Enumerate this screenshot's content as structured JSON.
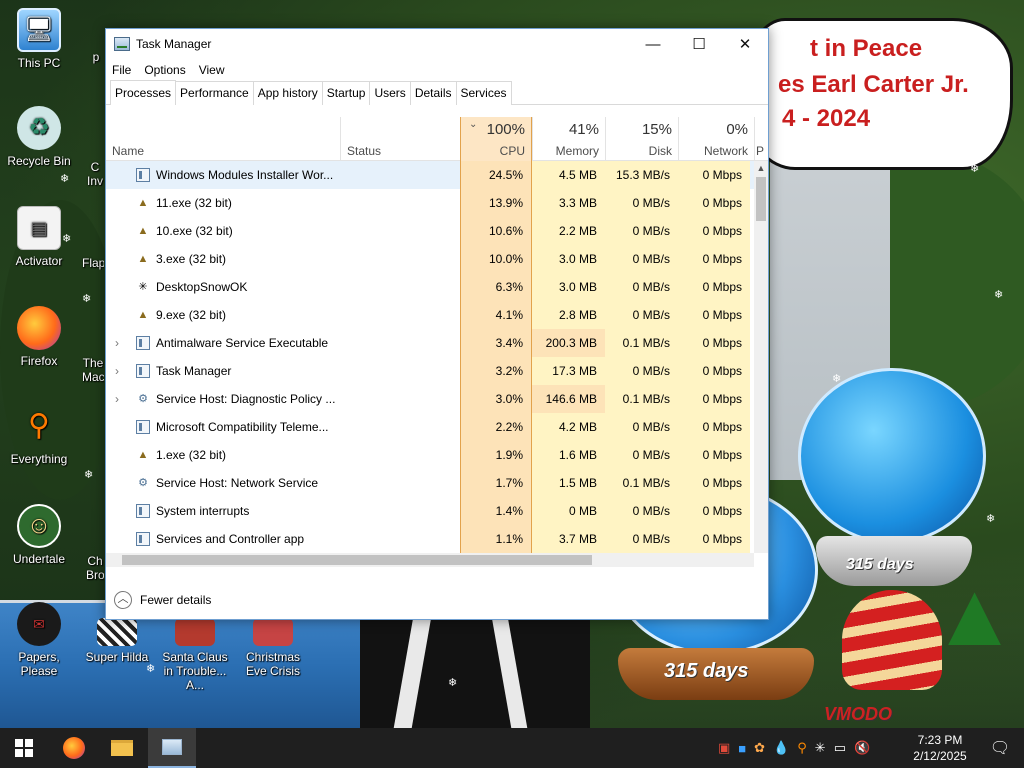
{
  "desktop": {
    "banner": {
      "line1": "t in Peace",
      "line2": "es Earl Carter Jr.",
      "line3": "4 - 2024"
    },
    "icons": [
      {
        "label": "This PC",
        "icon": "computer-icon"
      },
      {
        "label": "Recycle Bin",
        "icon": "recycle-bin-icon"
      },
      {
        "label": "Activator",
        "icon": "file-icon"
      },
      {
        "label": "Firefox",
        "icon": "firefox-icon"
      },
      {
        "label": "Everything",
        "icon": "magnifier-icon"
      },
      {
        "label": "Undertale",
        "icon": "undertale-icon"
      },
      {
        "label": "Papers, Please",
        "icon": "papers-please-icon"
      },
      {
        "label": "Super Hilda",
        "icon": "game-icon"
      },
      {
        "label": "Santa Claus in Trouble... A...",
        "icon": "santa-icon"
      },
      {
        "label": "Christmas Eve Crisis",
        "icon": "santa-icon"
      }
    ],
    "partial_icons": [
      {
        "label": "p"
      },
      {
        "label": "C Inv"
      },
      {
        "label": "Flap"
      },
      {
        "label": "The Mac"
      },
      {
        "label": "Ch Bro"
      }
    ],
    "globe_text_1": "315 days",
    "globe_text_2": "315 days",
    "watermark": "VMODO"
  },
  "taskmanager": {
    "title": "Task Manager",
    "window_controls": {
      "minimize": "—",
      "maximize": "☐",
      "close": "✕"
    },
    "menu": [
      "File",
      "Options",
      "View"
    ],
    "tabs": [
      "Processes",
      "Performance",
      "App history",
      "Startup",
      "Users",
      "Details",
      "Services"
    ],
    "active_tab": "Processes",
    "columns": {
      "name": "Name",
      "status": "Status",
      "cpu": {
        "pct": "100%",
        "label": "CPU"
      },
      "memory": {
        "pct": "41%",
        "label": "Memory"
      },
      "disk": {
        "pct": "15%",
        "label": "Disk"
      },
      "network": {
        "pct": "0%",
        "label": "Network"
      },
      "power": "P"
    },
    "rows": [
      {
        "name": "Windows Modules Installer Wor...",
        "cpu": "24.5%",
        "mem": "4.5 MB",
        "disk": "15.3 MB/s",
        "net": "0 Mbps",
        "icon": "window-icon",
        "expand": ""
      },
      {
        "name": "11.exe (32 bit)",
        "cpu": "13.9%",
        "mem": "3.3 MB",
        "disk": "0 MB/s",
        "net": "0 Mbps",
        "icon": "tree-icon",
        "expand": ""
      },
      {
        "name": "10.exe (32 bit)",
        "cpu": "10.6%",
        "mem": "2.2 MB",
        "disk": "0 MB/s",
        "net": "0 Mbps",
        "icon": "tree-icon",
        "expand": ""
      },
      {
        "name": "3.exe (32 bit)",
        "cpu": "10.0%",
        "mem": "3.0 MB",
        "disk": "0 MB/s",
        "net": "0 Mbps",
        "icon": "tree-icon",
        "expand": ""
      },
      {
        "name": "DesktopSnowOK",
        "cpu": "6.3%",
        "mem": "3.0 MB",
        "disk": "0 MB/s",
        "net": "0 Mbps",
        "icon": "snowflake-icon",
        "expand": ""
      },
      {
        "name": "9.exe (32 bit)",
        "cpu": "4.1%",
        "mem": "2.8 MB",
        "disk": "0 MB/s",
        "net": "0 Mbps",
        "icon": "tree-icon",
        "expand": ""
      },
      {
        "name": "Antimalware Service Executable",
        "cpu": "3.4%",
        "mem": "200.3 MB",
        "disk": "0.1 MB/s",
        "net": "0 Mbps",
        "icon": "window-icon",
        "expand": "›"
      },
      {
        "name": "Task Manager",
        "cpu": "3.2%",
        "mem": "17.3 MB",
        "disk": "0 MB/s",
        "net": "0 Mbps",
        "icon": "taskmgr-icon",
        "expand": "›"
      },
      {
        "name": "Service Host: Diagnostic Policy ...",
        "cpu": "3.0%",
        "mem": "146.6 MB",
        "disk": "0.1 MB/s",
        "net": "0 Mbps",
        "icon": "gear-icon",
        "expand": "›"
      },
      {
        "name": "Microsoft Compatibility Teleme...",
        "cpu": "2.2%",
        "mem": "4.2 MB",
        "disk": "0 MB/s",
        "net": "0 Mbps",
        "icon": "window-icon",
        "expand": ""
      },
      {
        "name": "1.exe (32 bit)",
        "cpu": "1.9%",
        "mem": "1.6 MB",
        "disk": "0 MB/s",
        "net": "0 Mbps",
        "icon": "tree-icon",
        "expand": ""
      },
      {
        "name": "Service Host: Network Service",
        "cpu": "1.7%",
        "mem": "1.5 MB",
        "disk": "0.1 MB/s",
        "net": "0 Mbps",
        "icon": "gear-icon",
        "expand": ""
      },
      {
        "name": "System interrupts",
        "cpu": "1.4%",
        "mem": "0 MB",
        "disk": "0 MB/s",
        "net": "0 Mbps",
        "icon": "window-icon",
        "expand": ""
      },
      {
        "name": "Services and Controller app",
        "cpu": "1.1%",
        "mem": "3.7 MB",
        "disk": "0 MB/s",
        "net": "0 Mbps",
        "icon": "window-icon",
        "expand": ""
      }
    ],
    "footer": {
      "label": "Fewer details",
      "icon": "chevron-up-icon"
    }
  },
  "taskbar": {
    "start_icon": "windows-logo-icon",
    "pinned": [
      "firefox-icon",
      "file-explorer-icon",
      "task-manager-icon"
    ],
    "tray_icons": [
      "media-icon",
      "blue-square-icon",
      "paint-icon",
      "water-drop-icon",
      "search-icon",
      "snowflake-icon",
      "network-icon",
      "volume-muted-icon"
    ],
    "time": "7:23 PM",
    "date": "2/12/2025",
    "notification_icon": "notification-icon"
  },
  "colors": {
    "cpu_header": "#fde6c5",
    "cpu_cells": "#fde3b8",
    "other_cells": "#fff4c4",
    "selected_row": "#e6f1fb",
    "banner_text": "#c91f1f"
  }
}
